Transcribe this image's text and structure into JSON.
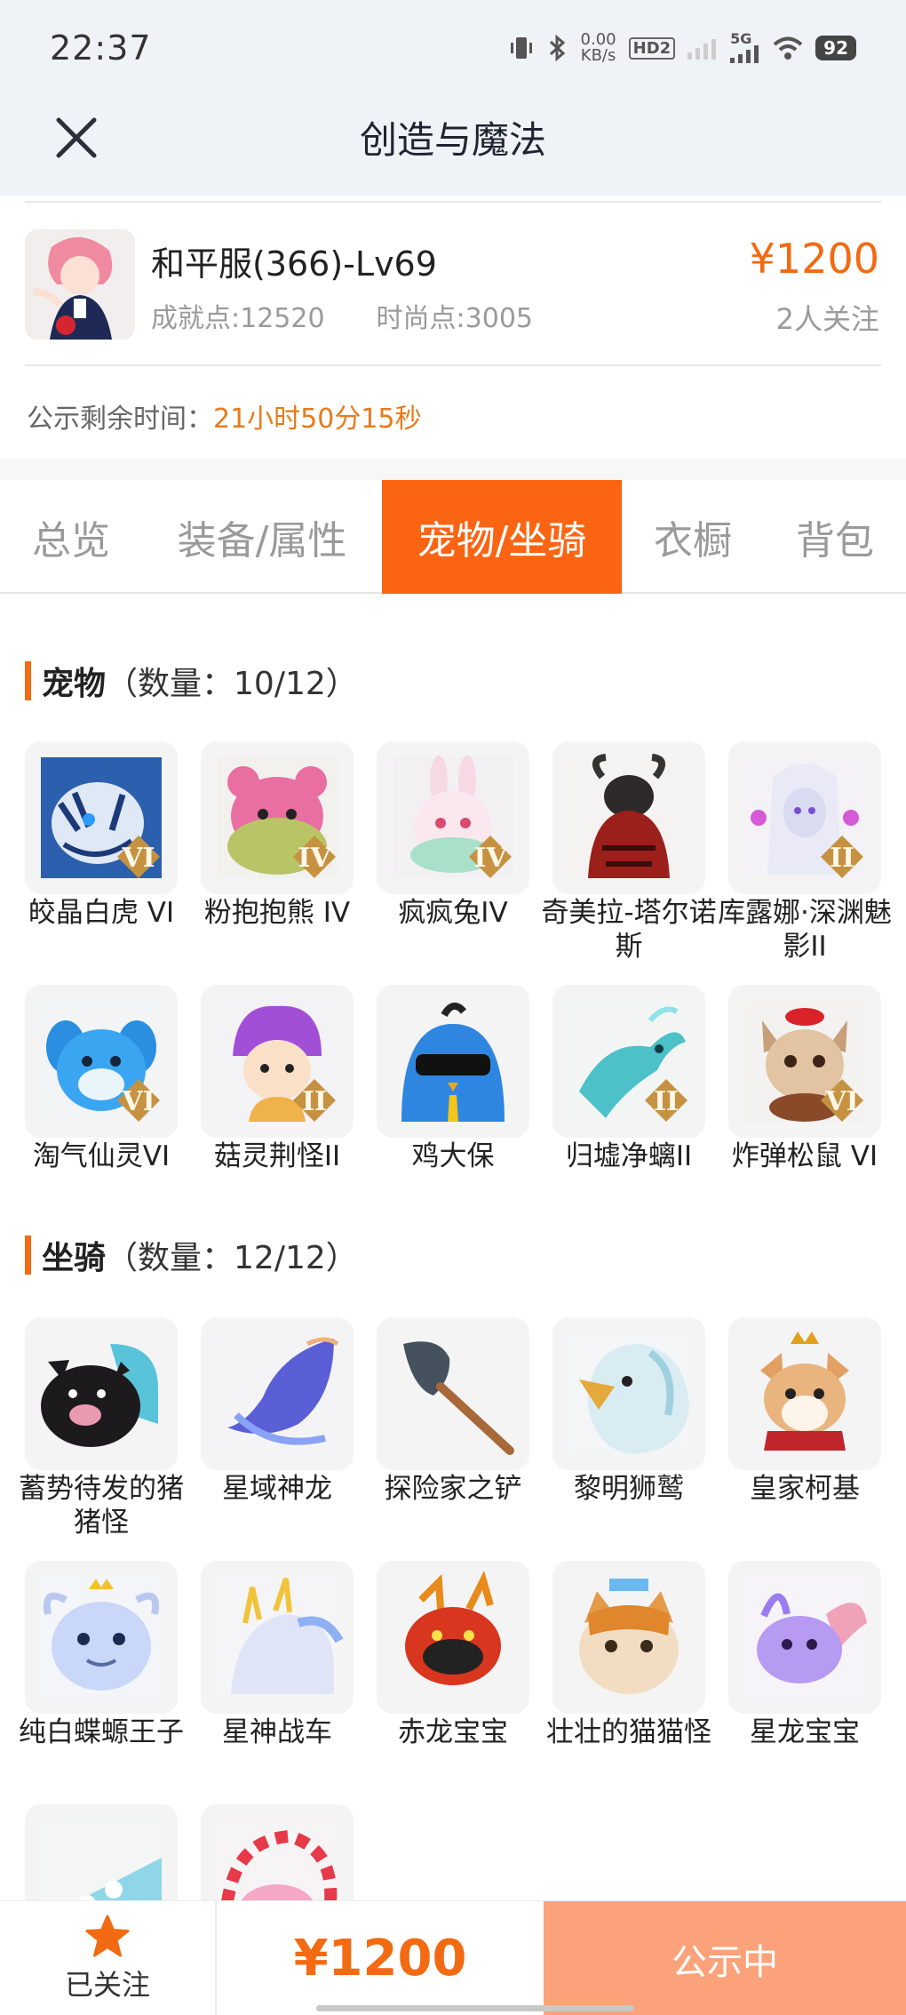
{
  "status_bar": {
    "time": "22:37",
    "net_speed_value": "0.00",
    "net_speed_unit": "KB/s",
    "hd_label": "HD2",
    "signal_label": "5G",
    "battery": "92"
  },
  "nav": {
    "title": "创造与魔法",
    "close_icon": "close-icon"
  },
  "account": {
    "name": "和平服(366)-Lv69",
    "achievement": "成就点:12520",
    "fashion": "时尚点:3005",
    "price": "¥1200",
    "followers": "2人关注",
    "timer_label": "公示剩余时间：",
    "timer_value": "21小时50分15秒"
  },
  "tabs": [
    {
      "label": "总览"
    },
    {
      "label": "装备/属性"
    },
    {
      "label": "宠物/坐骑",
      "active": true
    },
    {
      "label": "衣橱"
    },
    {
      "label": "背包"
    }
  ],
  "pets": {
    "title": "宠物",
    "count": "（数量：10/12）",
    "items": [
      {
        "label": "皎晶白虎 VI",
        "badge": "VI"
      },
      {
        "label": "粉抱抱熊 IV",
        "badge": "IV"
      },
      {
        "label": "疯疯兔IV",
        "badge": "IV"
      },
      {
        "label": "奇美拉-塔尔诺斯",
        "badge": ""
      },
      {
        "label": "库露娜·深渊魅影II",
        "badge": "II"
      },
      {
        "label": "淘气仙灵VI",
        "badge": "VI"
      },
      {
        "label": "菇灵荆怪II",
        "badge": "II"
      },
      {
        "label": "鸡大保",
        "badge": ""
      },
      {
        "label": "归墟净螭II",
        "badge": "II"
      },
      {
        "label": "炸弹松鼠 VI",
        "badge": "VI"
      }
    ]
  },
  "mounts": {
    "title": "坐骑",
    "count": "（数量：12/12）",
    "items": [
      {
        "label": "蓄势待发的猪猪怪"
      },
      {
        "label": "星域神龙"
      },
      {
        "label": "探险家之铲"
      },
      {
        "label": "黎明狮鹫"
      },
      {
        "label": "皇家柯基"
      },
      {
        "label": "纯白蝶螈王子"
      },
      {
        "label": "星神战车"
      },
      {
        "label": "赤龙宝宝"
      },
      {
        "label": "壮壮的猫猫怪"
      },
      {
        "label": "星龙宝宝"
      }
    ]
  },
  "bottom_bar": {
    "follow_label": "已关注",
    "price": "¥1200",
    "status_label": "公示中"
  },
  "colors": {
    "accent": "#fb6412",
    "price": "#f26a12",
    "status_button": "#fba27a"
  }
}
